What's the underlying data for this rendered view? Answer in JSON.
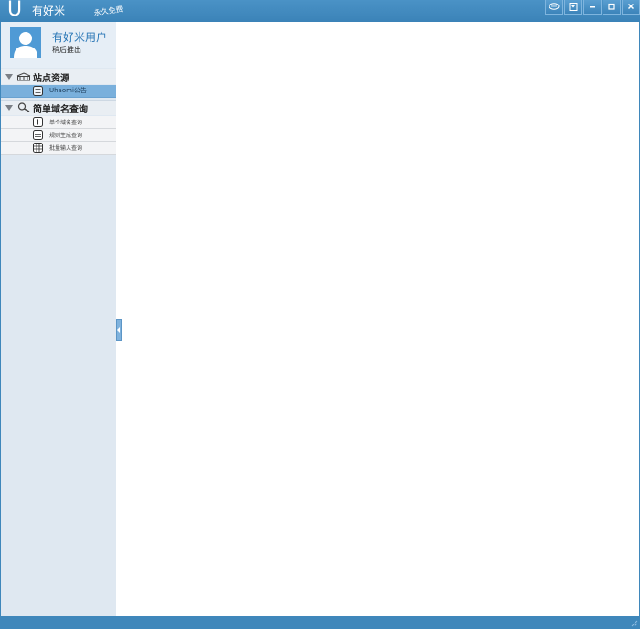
{
  "window": {
    "logo_letter": "U",
    "title": "有好米",
    "slogan": "永久免费",
    "buttons": [
      "chat-icon",
      "skin-icon",
      "minimize-icon",
      "maximize-icon",
      "close-icon"
    ],
    "accent_color": "#3f87bb"
  },
  "profile": {
    "name": "有好米用户",
    "status": "稍后推出"
  },
  "sidebar": {
    "groups": [
      {
        "label": "站点资源",
        "icon": "site-resource-icon",
        "items": [
          {
            "label": "Uhaomi公告",
            "icon": "notice-icon",
            "active": true
          }
        ]
      },
      {
        "label": "简单域名查询",
        "icon": "domain-search-icon",
        "items": [
          {
            "label": "单个域名查询",
            "icon": "single-query-icon",
            "active": false
          },
          {
            "label": "规则生成查询",
            "icon": "rule-query-icon",
            "active": false
          },
          {
            "label": "批量输入查询",
            "icon": "batch-query-icon",
            "active": false
          }
        ]
      }
    ]
  }
}
